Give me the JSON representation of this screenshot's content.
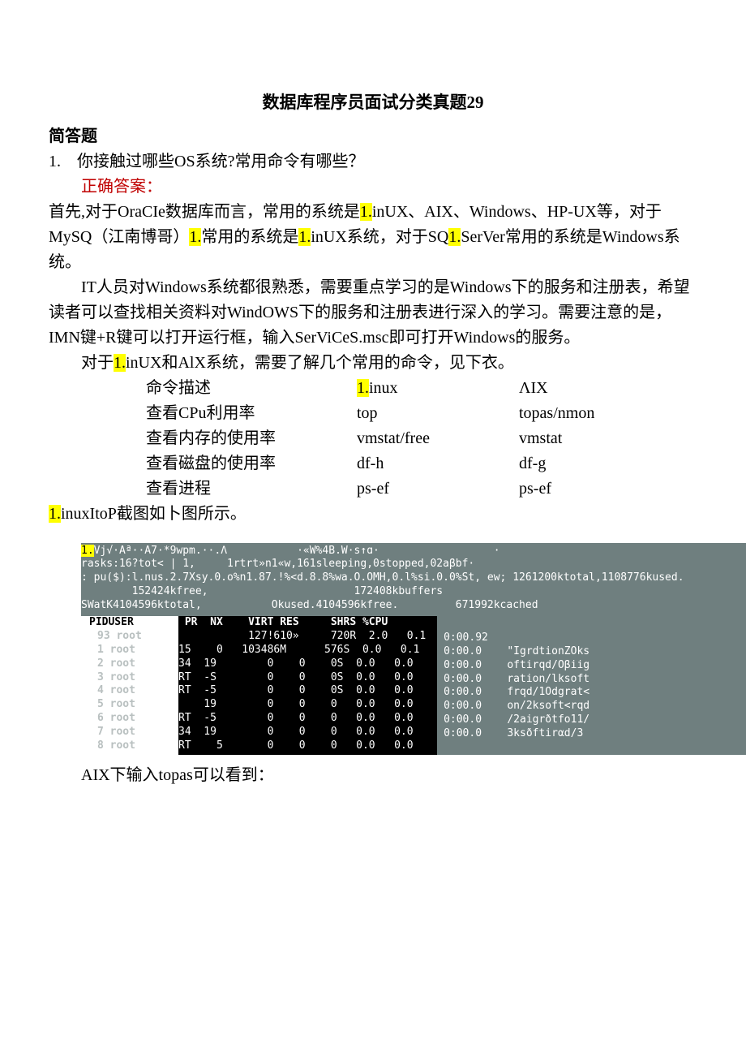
{
  "title": "数据库程序员面试分类真题29",
  "section": "简答题",
  "q_num": "1.",
  "q_text": "你接触过哪些OS系统?常用命令有哪些？",
  "answer_label": "正确答案：",
  "p1_a": "首先,对于OraCIe数据库而言，常用的系统是",
  "p1_h1": "1.",
  "p1_b": "inUX、AIX、Windows、HP-UX等，对于MySQ（江南博哥）",
  "p1_h2": "1.",
  "p1_c": "常用的系统是",
  "p1_h3": "1.",
  "p1_d": "inUX系统，对于SQ",
  "p1_h4": "1.",
  "p1_e": "SerVer常用的系统是Windows系统。",
  "p2": "IT人员对Windows系统都很熟悉，需要重点学习的是Windows下的服务和注册表，希望读者可以查找相关资料对WindOWS下的服务和注册表进行深入的学习。需要注意的是，IMN键+R键可以打开运行框，输入SerViCeS.msc即可打开Windows的服务。",
  "p3_a": "对于",
  "p3_h": "1.",
  "p3_b": "inUX和AlX系统，需要了解几个常用的命令，见下衣。",
  "table": {
    "h1": "命令描述",
    "h2_h": "1.",
    "h2_t": "inux",
    "h3": "ΛIX",
    "r1c1": "查看CPu利用率",
    "r1c2": "top",
    "r1c3": "topas/nmon",
    "r2c1": "查看内存的使用率",
    "r2c2": "vmstat/free",
    "r2c3": "vmstat",
    "r3c1": "查看磁盘的使用率",
    "r3c2": "df-h",
    "r3c3": "df-g",
    "r4c1": "查看进程",
    "r4c2": "ps-ef",
    "r4c3": "ps-ef"
  },
  "p4_h": "1.",
  "p4_t": "inuxItoP截图如卜图所示。",
  "term": {
    "l1_y": "1.",
    "l1": "Vj√·Aª··A7·*9wpm.··.Λ           ·«W%4B.W·s↑ɑ·                  ·",
    "l2": "rasks:16?tot< | 1,     1rtrt»n1«w,161sleeping,0stopped,02aβbf·",
    "l3": ": pu($):l.nus.2.7Xsy.0.o%n1.87.!%<d.8.8%wa.O.OMH,0.l%si.0.0%St, ew; 1261200ktotal,1108776kused.",
    "l4": "        152424kfree,                       172408kbuffers",
    "l5": "SWatK4104596ktotal,           Okused.4104596kfree.         671992kcached",
    "left_hdr": "PIDUSER",
    "ghost": [
      "93 root",
      "1 root",
      "2 root",
      "3 root",
      "4 root",
      "5 root",
      "6 root",
      "7 root",
      "8 root"
    ],
    "mid_hdr": " PR  NX    VIRT RES     SHRS %CPU       ",
    "mid_rows": [
      "           127!610»     720R  2.0   0.1",
      "15    0   103486M      576S  0.0   0.1",
      "34  19        0    0    0S  0.0   0.0",
      "RT  -S        0    0    0S  0.0   0.0",
      "RT  -5        0    0    0S  0.0   0.0",
      "    19        0    0    0   0.0   0.0",
      "RT  -5        0    0    0   0.0   0.0",
      "34  19        0    0    0   0.0   0.0",
      "RT    5       0    0    0   0.0   0.0"
    ],
    "right_rows": [
      "0:00.92",
      "0:00.0    \"IgrdtionZOks",
      "0:00.0    oftirqd/Oβiig",
      "0:00.0    ration/lksoft",
      "0:00.0    frqd/1Odgrat<",
      "0:00.0    on/2ksoft<rqd",
      "0:00.0    /2aigrðtfo11/",
      "0:00.0    3ksðftirαd/3"
    ]
  },
  "p5": "AIX下输入topas可以看到："
}
